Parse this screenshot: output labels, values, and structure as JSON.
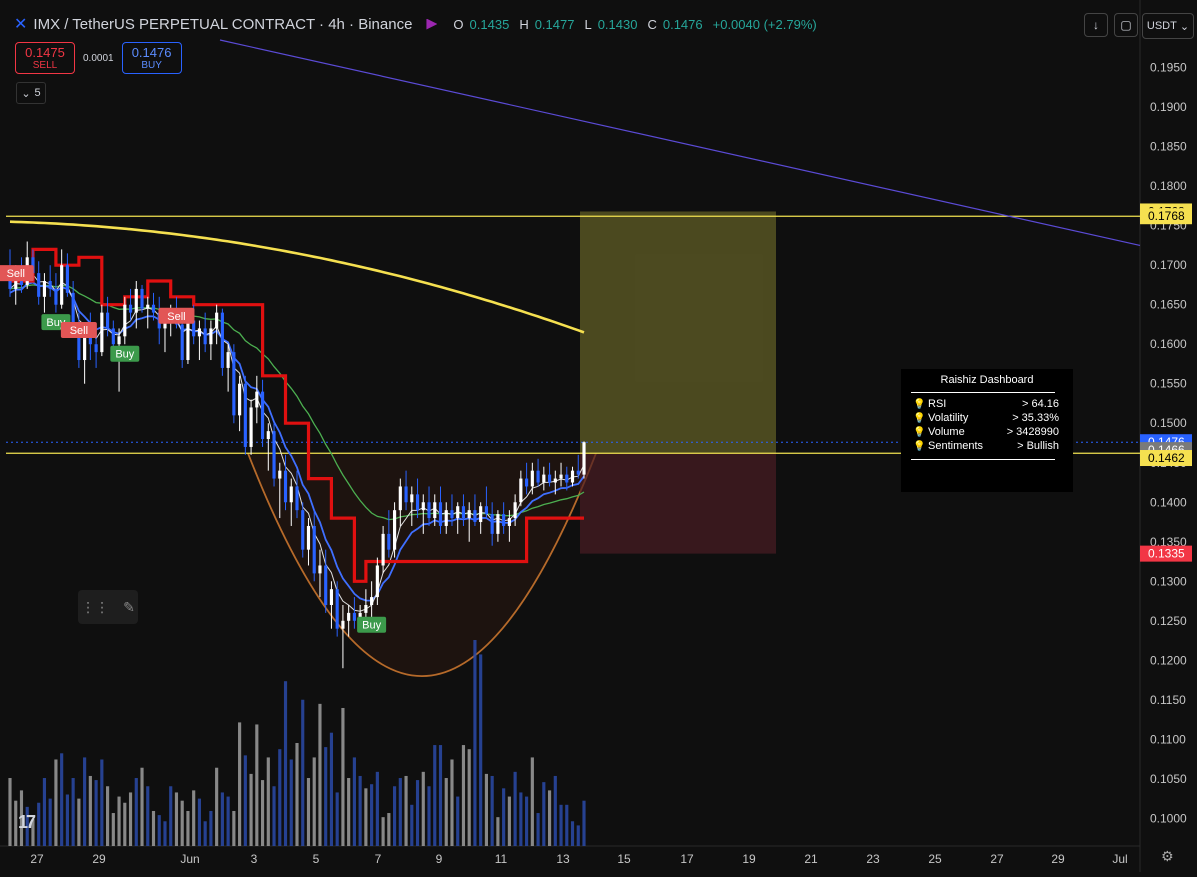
{
  "header": {
    "symbol_icon": "imx-icon",
    "title": "IMX / TetherUS PERPETUAL CONTRACT · 4h · Binance",
    "open_label": "O",
    "open": "0.1435",
    "high_label": "H",
    "high": "0.1477",
    "low_label": "L",
    "low": "0.1430",
    "close_label": "C",
    "close": "0.1476",
    "change": "+0.0040 (+2.79%)"
  },
  "trade": {
    "sell_price": "0.1475",
    "sell_label": "SELL",
    "spread": "0.0001",
    "buy_price": "0.1476",
    "buy_label": "BUY"
  },
  "indicators_count": "5",
  "currency": "USDT",
  "dashboard": {
    "title": "Raishiz Dashboard",
    "rows": [
      {
        "label": "RSI",
        "value": "> 64.16"
      },
      {
        "label": "Volatility",
        "value": "> 35.33%"
      },
      {
        "label": "Volume",
        "value": "> 3428990"
      },
      {
        "label": "Sentiments",
        "value": "> Bullish"
      }
    ]
  },
  "colors": {
    "background": "#0f0f0f",
    "up": "#ffffff",
    "down": "#2962ff",
    "sma200": "#f5e050",
    "green_ma": "#4caf50",
    "trend_line": "#5b4bd6",
    "horizontal": "#f0e250",
    "target_zone": "#7d7a2e",
    "stop_zone": "#4a1c24",
    "cup": "#b66a2a"
  },
  "chart_data": {
    "type": "candlestick",
    "y_axis_ticks": [
      "0.1950",
      "0.1900",
      "0.1850",
      "0.1800",
      "0.1750",
      "0.1700",
      "0.1650",
      "0.1600",
      "0.1550",
      "0.1500",
      "0.1450",
      "0.1400",
      "0.1350",
      "0.1300",
      "0.1250",
      "0.1200",
      "0.1150",
      "0.1100",
      "0.1050",
      "0.1000"
    ],
    "ylim": [
      0.0965,
      0.1985
    ],
    "x_axis_ticks": [
      "27",
      "29",
      "Jun",
      "3",
      "5",
      "7",
      "9",
      "11",
      "13",
      "15",
      "17",
      "19",
      "21",
      "23",
      "25",
      "27",
      "29",
      "Jul"
    ],
    "price_labels": [
      {
        "value": 0.1768,
        "text": "0.1768",
        "color": "#f5e050"
      },
      {
        "value": 0.1762,
        "text": "0.1768",
        "color": "#f5e050"
      },
      {
        "value": 0.1476,
        "text": "0.1476",
        "color": "#2962ff"
      },
      {
        "value": 0.1466,
        "text": "0.1466",
        "color": "#7a7a7a"
      },
      {
        "value": 0.1456,
        "text": "0.1462",
        "color": "#f5e050"
      },
      {
        "value": 0.1335,
        "text": "0.1335",
        "color": "#f23645"
      }
    ],
    "horizontal_lines": [
      0.1762,
      0.1462
    ],
    "signals": [
      {
        "label": "Sell",
        "type": "sell",
        "bar": 1,
        "price": 0.169
      },
      {
        "label": "Buy",
        "type": "buy",
        "bar": 8,
        "price": 0.1628
      },
      {
        "label": "Sell",
        "type": "sell",
        "bar": 12,
        "price": 0.1618
      },
      {
        "label": "Buy",
        "type": "buy",
        "bar": 20,
        "price": 0.1588
      },
      {
        "label": "Sell",
        "type": "sell",
        "bar": 29,
        "price": 0.1636
      },
      {
        "label": "Buy",
        "type": "buy",
        "bar": 63,
        "price": 0.1245
      }
    ],
    "position": {
      "entry": 0.1462,
      "target": 0.1768,
      "stop": 0.1335
    },
    "candles": [
      [
        0.169,
        0.172,
        0.166,
        0.167
      ],
      [
        0.167,
        0.17,
        0.165,
        0.169
      ],
      [
        0.169,
        0.171,
        0.1665,
        0.1675
      ],
      [
        0.1675,
        0.173,
        0.167,
        0.171
      ],
      [
        0.171,
        0.172,
        0.168,
        0.169
      ],
      [
        0.169,
        0.1705,
        0.165,
        0.166
      ],
      [
        0.166,
        0.169,
        0.164,
        0.168
      ],
      [
        0.168,
        0.17,
        0.166,
        0.167
      ],
      [
        0.167,
        0.169,
        0.164,
        0.165
      ],
      [
        0.165,
        0.172,
        0.1645,
        0.17
      ],
      [
        0.17,
        0.1715,
        0.166,
        0.1665
      ],
      [
        0.1665,
        0.168,
        0.161,
        0.162
      ],
      [
        0.162,
        0.164,
        0.157,
        0.158
      ],
      [
        0.158,
        0.162,
        0.155,
        0.161
      ],
      [
        0.161,
        0.164,
        0.158,
        0.16
      ],
      [
        0.16,
        0.162,
        0.157,
        0.159
      ],
      [
        0.159,
        0.165,
        0.1585,
        0.164
      ],
      [
        0.164,
        0.166,
        0.161,
        0.162
      ],
      [
        0.162,
        0.163,
        0.158,
        0.16
      ],
      [
        0.16,
        0.162,
        0.154,
        0.161
      ],
      [
        0.161,
        0.166,
        0.16,
        0.165
      ],
      [
        0.165,
        0.167,
        0.163,
        0.164
      ],
      [
        0.164,
        0.168,
        0.162,
        0.167
      ],
      [
        0.167,
        0.1675,
        0.164,
        0.1645
      ],
      [
        0.1645,
        0.166,
        0.162,
        0.165
      ],
      [
        0.165,
        0.1665,
        0.163,
        0.164
      ],
      [
        0.164,
        0.166,
        0.16,
        0.162
      ],
      [
        0.162,
        0.164,
        0.159,
        0.163
      ],
      [
        0.163,
        0.165,
        0.161,
        0.164
      ],
      [
        0.164,
        0.166,
        0.162,
        0.1625
      ],
      [
        0.1625,
        0.164,
        0.157,
        0.158
      ],
      [
        0.158,
        0.164,
        0.1575,
        0.163
      ],
      [
        0.163,
        0.165,
        0.16,
        0.161
      ],
      [
        0.161,
        0.163,
        0.158,
        0.162
      ],
      [
        0.162,
        0.164,
        0.159,
        0.16
      ],
      [
        0.16,
        0.163,
        0.158,
        0.162
      ],
      [
        0.162,
        0.165,
        0.16,
        0.164
      ],
      [
        0.164,
        0.1645,
        0.156,
        0.157
      ],
      [
        0.157,
        0.16,
        0.154,
        0.159
      ],
      [
        0.159,
        0.16,
        0.15,
        0.151
      ],
      [
        0.151,
        0.156,
        0.149,
        0.155
      ],
      [
        0.155,
        0.156,
        0.146,
        0.147
      ],
      [
        0.147,
        0.153,
        0.146,
        0.152
      ],
      [
        0.152,
        0.156,
        0.15,
        0.154
      ],
      [
        0.154,
        0.1555,
        0.147,
        0.148
      ],
      [
        0.148,
        0.15,
        0.144,
        0.149
      ],
      [
        0.149,
        0.15,
        0.142,
        0.143
      ],
      [
        0.143,
        0.145,
        0.138,
        0.144
      ],
      [
        0.144,
        0.146,
        0.139,
        0.14
      ],
      [
        0.14,
        0.143,
        0.137,
        0.142
      ],
      [
        0.142,
        0.144,
        0.138,
        0.139
      ],
      [
        0.139,
        0.14,
        0.133,
        0.134
      ],
      [
        0.134,
        0.138,
        0.132,
        0.137
      ],
      [
        0.137,
        0.139,
        0.13,
        0.131
      ],
      [
        0.131,
        0.134,
        0.128,
        0.132
      ],
      [
        0.132,
        0.134,
        0.126,
        0.127
      ],
      [
        0.127,
        0.13,
        0.124,
        0.129
      ],
      [
        0.129,
        0.13,
        0.123,
        0.124
      ],
      [
        0.124,
        0.127,
        0.119,
        0.125
      ],
      [
        0.125,
        0.127,
        0.123,
        0.126
      ],
      [
        0.126,
        0.128,
        0.124,
        0.125
      ],
      [
        0.125,
        0.127,
        0.124,
        0.126
      ],
      [
        0.126,
        0.129,
        0.125,
        0.127
      ],
      [
        0.127,
        0.13,
        0.125,
        0.128
      ],
      [
        0.128,
        0.133,
        0.127,
        0.132
      ],
      [
        0.132,
        0.137,
        0.131,
        0.136
      ],
      [
        0.136,
        0.139,
        0.133,
        0.134
      ],
      [
        0.134,
        0.14,
        0.133,
        0.139
      ],
      [
        0.139,
        0.143,
        0.137,
        0.142
      ],
      [
        0.142,
        0.144,
        0.139,
        0.14
      ],
      [
        0.14,
        0.142,
        0.137,
        0.141
      ],
      [
        0.141,
        0.143,
        0.138,
        0.139
      ],
      [
        0.139,
        0.141,
        0.136,
        0.14
      ],
      [
        0.14,
        0.142,
        0.137,
        0.138
      ],
      [
        0.138,
        0.141,
        0.137,
        0.14
      ],
      [
        0.14,
        0.142,
        0.136,
        0.137
      ],
      [
        0.137,
        0.14,
        0.136,
        0.139
      ],
      [
        0.139,
        0.141,
        0.137,
        0.138
      ],
      [
        0.138,
        0.14,
        0.136,
        0.1395
      ],
      [
        0.1395,
        0.141,
        0.137,
        0.138
      ],
      [
        0.138,
        0.14,
        0.135,
        0.139
      ],
      [
        0.139,
        0.141,
        0.137,
        0.1375
      ],
      [
        0.1375,
        0.14,
        0.136,
        0.1395
      ],
      [
        0.1395,
        0.142,
        0.138,
        0.1385
      ],
      [
        0.1385,
        0.14,
        0.1345,
        0.136
      ],
      [
        0.136,
        0.139,
        0.135,
        0.1385
      ],
      [
        0.1385,
        0.14,
        0.136,
        0.137
      ],
      [
        0.137,
        0.139,
        0.135,
        0.138
      ],
      [
        0.138,
        0.141,
        0.137,
        0.14
      ],
      [
        0.14,
        0.144,
        0.1395,
        0.143
      ],
      [
        0.143,
        0.145,
        0.141,
        0.142
      ],
      [
        0.142,
        0.145,
        0.141,
        0.144
      ],
      [
        0.144,
        0.1455,
        0.142,
        0.1425
      ],
      [
        0.1425,
        0.1445,
        0.1415,
        0.1435
      ],
      [
        0.1435,
        0.145,
        0.142,
        0.1425
      ],
      [
        0.1425,
        0.144,
        0.141,
        0.143
      ],
      [
        0.143,
        0.145,
        0.142,
        0.1435
      ],
      [
        0.1435,
        0.1445,
        0.1415,
        0.1425
      ],
      [
        0.1425,
        0.1445,
        0.142,
        0.144
      ],
      [
        0.144,
        0.146,
        0.143,
        0.1435
      ],
      [
        0.1435,
        0.1477,
        0.143,
        0.1476
      ]
    ],
    "volumes": [
      0.33,
      0.22,
      0.27,
      0.19,
      0.13,
      0.21,
      0.33,
      0.23,
      0.42,
      0.45,
      0.25,
      0.33,
      0.23,
      0.43,
      0.34,
      0.32,
      0.42,
      0.29,
      0.16,
      0.24,
      0.21,
      0.26,
      0.33,
      0.38,
      0.29,
      0.17,
      0.15,
      0.12,
      0.29,
      0.26,
      0.22,
      0.17,
      0.27,
      0.23,
      0.12,
      0.17,
      0.38,
      0.26,
      0.24,
      0.17,
      0.6,
      0.44,
      0.35,
      0.59,
      0.32,
      0.43,
      0.29,
      0.47,
      0.8,
      0.42,
      0.5,
      0.71,
      0.33,
      0.43,
      0.69,
      0.48,
      0.55,
      0.26,
      0.67,
      0.33,
      0.43,
      0.34,
      0.28,
      0.3,
      0.36,
      0.14,
      0.16,
      0.29,
      0.33,
      0.34,
      0.2,
      0.32,
      0.36,
      0.29,
      0.49,
      0.49,
      0.33,
      0.42,
      0.24,
      0.49,
      0.47,
      1.0,
      0.93,
      0.35,
      0.34,
      0.14,
      0.28,
      0.24,
      0.36,
      0.26,
      0.24,
      0.43,
      0.16,
      0.31,
      0.27,
      0.34,
      0.2,
      0.2,
      0.12,
      0.1,
      0.22
    ],
    "volume_colors": [
      "up",
      "up",
      "up",
      "down",
      "up",
      "down",
      "down",
      "down",
      "up",
      "down",
      "down",
      "down",
      "up",
      "down",
      "up",
      "down",
      "down",
      "up",
      "up",
      "up",
      "up",
      "up",
      "down",
      "up",
      "down",
      "up",
      "down",
      "down",
      "down",
      "up",
      "up",
      "up",
      "up",
      "down",
      "down",
      "down",
      "up",
      "down",
      "down",
      "up",
      "up",
      "down",
      "up",
      "up",
      "up",
      "up",
      "down",
      "down",
      "down",
      "down",
      "up",
      "down",
      "up",
      "up",
      "up",
      "down",
      "down",
      "down",
      "up",
      "up",
      "down",
      "down",
      "up",
      "down",
      "down",
      "up",
      "up",
      "down",
      "down",
      "up",
      "down",
      "down",
      "up",
      "down",
      "down",
      "down",
      "up",
      "up",
      "down",
      "up",
      "up",
      "down",
      "down",
      "up",
      "down",
      "up",
      "down",
      "up",
      "down",
      "down",
      "down",
      "up",
      "down",
      "down",
      "up",
      "down",
      "down",
      "down",
      "down",
      "down",
      "down"
    ]
  }
}
